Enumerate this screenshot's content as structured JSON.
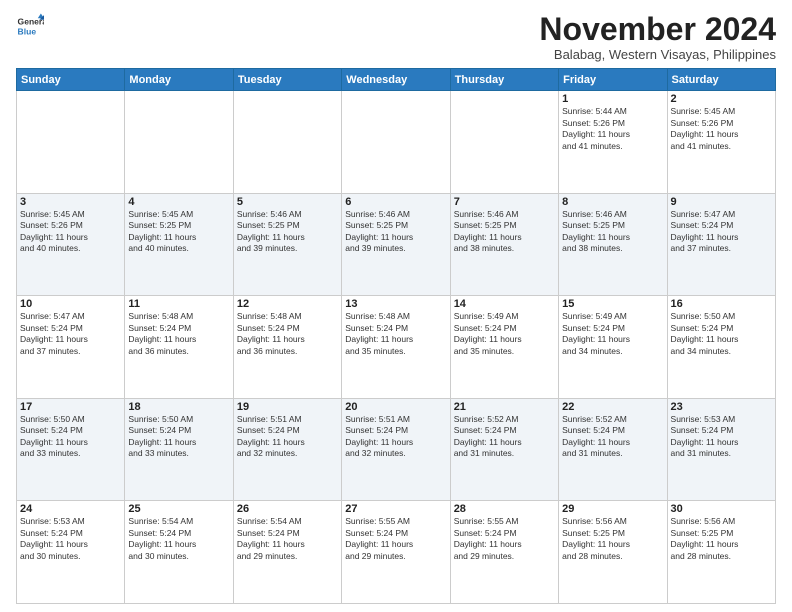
{
  "header": {
    "logo_line1": "General",
    "logo_line2": "Blue",
    "month_year": "November 2024",
    "location": "Balabag, Western Visayas, Philippines"
  },
  "days_of_week": [
    "Sunday",
    "Monday",
    "Tuesday",
    "Wednesday",
    "Thursday",
    "Friday",
    "Saturday"
  ],
  "weeks": [
    [
      {
        "day": "",
        "info": ""
      },
      {
        "day": "",
        "info": ""
      },
      {
        "day": "",
        "info": ""
      },
      {
        "day": "",
        "info": ""
      },
      {
        "day": "",
        "info": ""
      },
      {
        "day": "1",
        "info": "Sunrise: 5:44 AM\nSunset: 5:26 PM\nDaylight: 11 hours\nand 41 minutes."
      },
      {
        "day": "2",
        "info": "Sunrise: 5:45 AM\nSunset: 5:26 PM\nDaylight: 11 hours\nand 41 minutes."
      }
    ],
    [
      {
        "day": "3",
        "info": "Sunrise: 5:45 AM\nSunset: 5:26 PM\nDaylight: 11 hours\nand 40 minutes."
      },
      {
        "day": "4",
        "info": "Sunrise: 5:45 AM\nSunset: 5:25 PM\nDaylight: 11 hours\nand 40 minutes."
      },
      {
        "day": "5",
        "info": "Sunrise: 5:46 AM\nSunset: 5:25 PM\nDaylight: 11 hours\nand 39 minutes."
      },
      {
        "day": "6",
        "info": "Sunrise: 5:46 AM\nSunset: 5:25 PM\nDaylight: 11 hours\nand 39 minutes."
      },
      {
        "day": "7",
        "info": "Sunrise: 5:46 AM\nSunset: 5:25 PM\nDaylight: 11 hours\nand 38 minutes."
      },
      {
        "day": "8",
        "info": "Sunrise: 5:46 AM\nSunset: 5:25 PM\nDaylight: 11 hours\nand 38 minutes."
      },
      {
        "day": "9",
        "info": "Sunrise: 5:47 AM\nSunset: 5:24 PM\nDaylight: 11 hours\nand 37 minutes."
      }
    ],
    [
      {
        "day": "10",
        "info": "Sunrise: 5:47 AM\nSunset: 5:24 PM\nDaylight: 11 hours\nand 37 minutes."
      },
      {
        "day": "11",
        "info": "Sunrise: 5:48 AM\nSunset: 5:24 PM\nDaylight: 11 hours\nand 36 minutes."
      },
      {
        "day": "12",
        "info": "Sunrise: 5:48 AM\nSunset: 5:24 PM\nDaylight: 11 hours\nand 36 minutes."
      },
      {
        "day": "13",
        "info": "Sunrise: 5:48 AM\nSunset: 5:24 PM\nDaylight: 11 hours\nand 35 minutes."
      },
      {
        "day": "14",
        "info": "Sunrise: 5:49 AM\nSunset: 5:24 PM\nDaylight: 11 hours\nand 35 minutes."
      },
      {
        "day": "15",
        "info": "Sunrise: 5:49 AM\nSunset: 5:24 PM\nDaylight: 11 hours\nand 34 minutes."
      },
      {
        "day": "16",
        "info": "Sunrise: 5:50 AM\nSunset: 5:24 PM\nDaylight: 11 hours\nand 34 minutes."
      }
    ],
    [
      {
        "day": "17",
        "info": "Sunrise: 5:50 AM\nSunset: 5:24 PM\nDaylight: 11 hours\nand 33 minutes."
      },
      {
        "day": "18",
        "info": "Sunrise: 5:50 AM\nSunset: 5:24 PM\nDaylight: 11 hours\nand 33 minutes."
      },
      {
        "day": "19",
        "info": "Sunrise: 5:51 AM\nSunset: 5:24 PM\nDaylight: 11 hours\nand 32 minutes."
      },
      {
        "day": "20",
        "info": "Sunrise: 5:51 AM\nSunset: 5:24 PM\nDaylight: 11 hours\nand 32 minutes."
      },
      {
        "day": "21",
        "info": "Sunrise: 5:52 AM\nSunset: 5:24 PM\nDaylight: 11 hours\nand 31 minutes."
      },
      {
        "day": "22",
        "info": "Sunrise: 5:52 AM\nSunset: 5:24 PM\nDaylight: 11 hours\nand 31 minutes."
      },
      {
        "day": "23",
        "info": "Sunrise: 5:53 AM\nSunset: 5:24 PM\nDaylight: 11 hours\nand 31 minutes."
      }
    ],
    [
      {
        "day": "24",
        "info": "Sunrise: 5:53 AM\nSunset: 5:24 PM\nDaylight: 11 hours\nand 30 minutes."
      },
      {
        "day": "25",
        "info": "Sunrise: 5:54 AM\nSunset: 5:24 PM\nDaylight: 11 hours\nand 30 minutes."
      },
      {
        "day": "26",
        "info": "Sunrise: 5:54 AM\nSunset: 5:24 PM\nDaylight: 11 hours\nand 29 minutes."
      },
      {
        "day": "27",
        "info": "Sunrise: 5:55 AM\nSunset: 5:24 PM\nDaylight: 11 hours\nand 29 minutes."
      },
      {
        "day": "28",
        "info": "Sunrise: 5:55 AM\nSunset: 5:24 PM\nDaylight: 11 hours\nand 29 minutes."
      },
      {
        "day": "29",
        "info": "Sunrise: 5:56 AM\nSunset: 5:25 PM\nDaylight: 11 hours\nand 28 minutes."
      },
      {
        "day": "30",
        "info": "Sunrise: 5:56 AM\nSunset: 5:25 PM\nDaylight: 11 hours\nand 28 minutes."
      }
    ]
  ]
}
